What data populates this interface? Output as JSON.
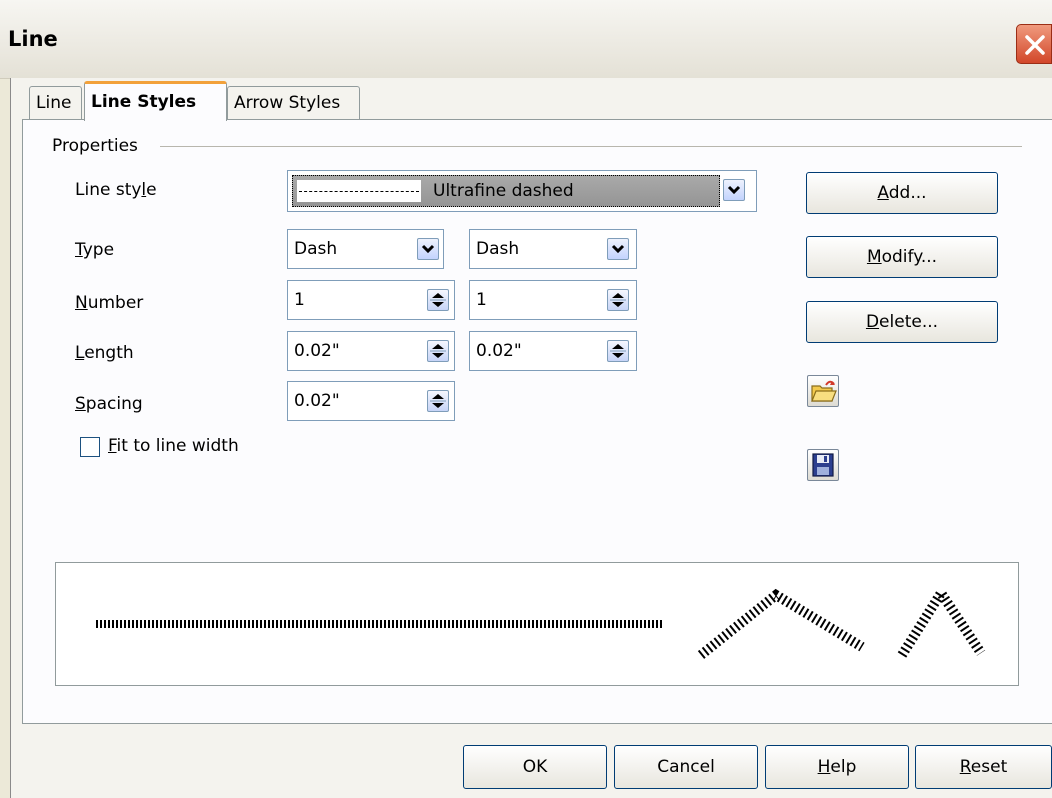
{
  "window": {
    "title": "Line"
  },
  "tabs": [
    {
      "label": "Line"
    },
    {
      "label": "Line Styles"
    },
    {
      "label": "Arrow Styles"
    }
  ],
  "properties": {
    "group_label": "Properties",
    "line_style": {
      "label_pre": "Line sty",
      "label_u": "l",
      "label_post": "e",
      "value": "Ultrafine dashed"
    },
    "type": {
      "label_u": "T",
      "label_post": "ype",
      "value1": "Dash",
      "value2": "Dash"
    },
    "number": {
      "label_u": "N",
      "label_post": "umber",
      "value1": "1",
      "value2": "1"
    },
    "length": {
      "label_u": "L",
      "label_post": "ength",
      "value1": "0.02\"",
      "value2": "0.02\""
    },
    "spacing": {
      "label_u": "S",
      "label_post": "pacing",
      "value": "0.02\""
    },
    "fit_to_line_width": {
      "label_u": "F",
      "label_post": "it to line width",
      "checked": false
    }
  },
  "side_buttons": {
    "add": {
      "label_u": "A",
      "label_post": "dd..."
    },
    "modify": {
      "label_u": "M",
      "label_post": "odify..."
    },
    "delete": {
      "label_u": "D",
      "label_post": "elete..."
    },
    "load_icon": "folder-open-icon",
    "save_icon": "floppy-save-icon"
  },
  "footer": {
    "ok": "OK",
    "cancel": "Cancel",
    "help_u": "H",
    "help_post": "elp",
    "reset_u": "R",
    "reset_post": "eset"
  },
  "colors": {
    "active_tab_accent": "#f2a13a",
    "close_button": "#d2472a",
    "field_border": "#7f9db9"
  }
}
